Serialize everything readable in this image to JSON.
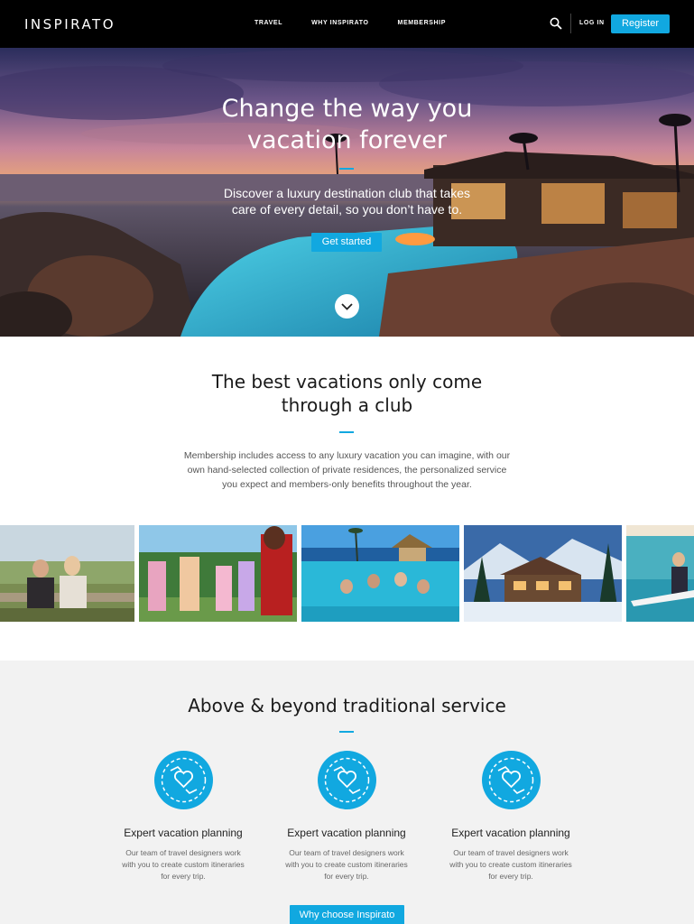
{
  "nav": {
    "logo": "INSPIRATO",
    "links": [
      "TRAVEL",
      "WHY INSPIRATO",
      "MEMBERSHIP"
    ],
    "login": "LOG IN",
    "register": "Register"
  },
  "hero": {
    "title_line1": "Change the way you",
    "title_line2": "vacation forever",
    "subtitle_line1": "Discover a luxury destination club that takes",
    "subtitle_line2": "care of every detail, so you don’t have to.",
    "cta": "Get started"
  },
  "club": {
    "title_line1": "The best vacations only come",
    "title_line2": "through a club",
    "desc_line1": "Membership includes access to any luxury vacation you can imagine, with our",
    "desc_line2": "own hand-selected collection of private residences, the personalized service",
    "desc_line3": "you expect and members-only benefits throughout the year."
  },
  "service": {
    "title": "Above & beyond traditional service",
    "features": [
      {
        "title": "Expert vacation planning",
        "desc": "Our team of travel designers work with you to create custom itineraries for every trip."
      },
      {
        "title": "Expert vacation planning",
        "desc": "Our team of travel designers work with you to create custom itineraries for every trip."
      },
      {
        "title": "Expert vacation planning",
        "desc": "Our team of travel designers work with you to create custom itineraries for every trip."
      }
    ],
    "cta": "Why choose Inspirato"
  },
  "colors": {
    "accent": "#11a8e0",
    "nav_bg": "#000000",
    "section_bg": "#f2f2f2"
  },
  "icons": [
    "search-icon",
    "chevron-down-icon",
    "heart-hands-icon"
  ]
}
